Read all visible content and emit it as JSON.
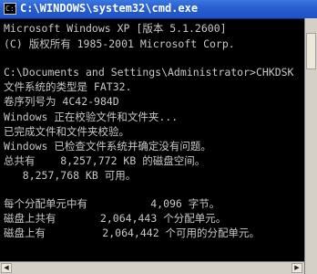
{
  "window": {
    "title": "C:\\WINDOWS\\system32\\cmd.exe",
    "icon_text": "C:\\"
  },
  "console": {
    "lines": [
      "Microsoft Windows XP [版本 5.1.2600]",
      "(C) 版权所有 1985-2001 Microsoft Corp.",
      "",
      "C:\\Documents and Settings\\Administrator>CHKDSK",
      "文件系统的类型是 FAT32.",
      "卷序列号为 4C42-984D",
      "Windows 正在校验文件和文件夹...",
      "已完成文件和文件夹校验。",
      "Windows 已检查文件系统并确定没有问题。",
      "总共有    8,257,772 KB 的磁盘空间。",
      "   8,257,768 KB 可用。",
      "",
      "每个分配单元中有          4,096 字节。",
      "磁盘上共有       2,064,443 个分配单元。",
      "磁盘上有         2,064,442 个可用的分配单元。"
    ]
  },
  "colors": {
    "console_text": "#c8c8c8",
    "console_bg": "#000000",
    "titlebar": "#2a5fd0"
  }
}
